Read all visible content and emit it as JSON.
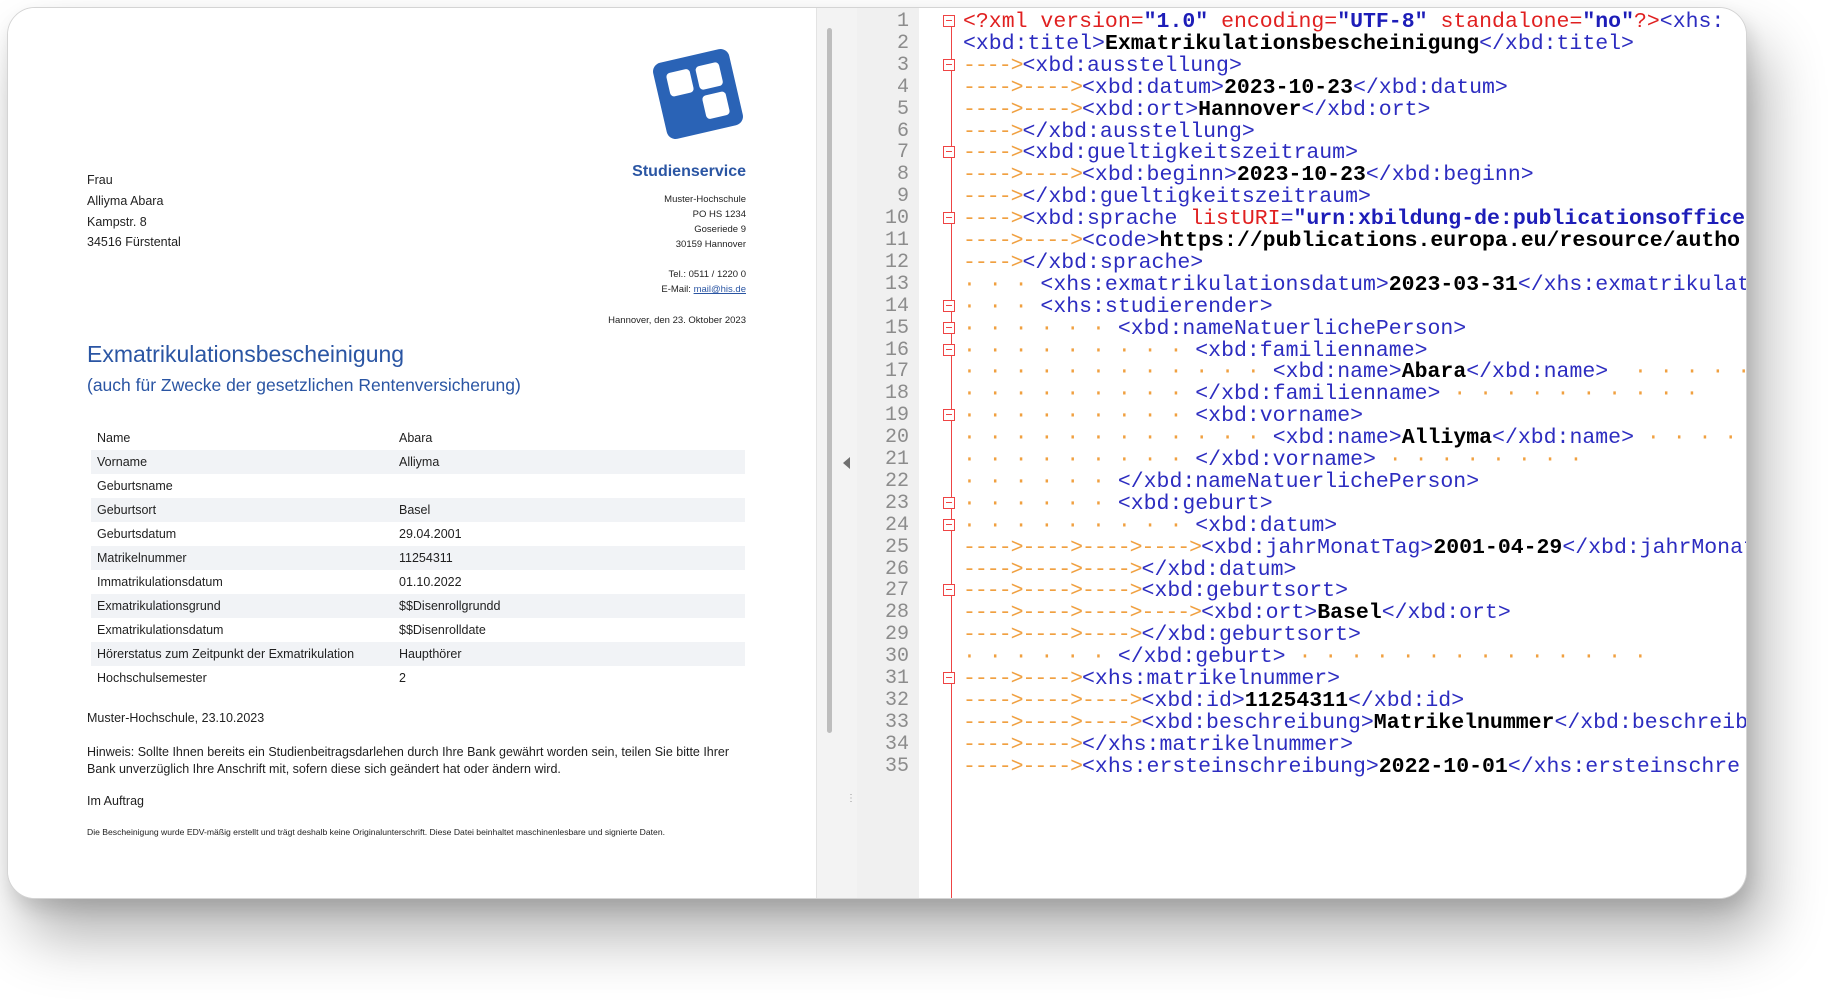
{
  "document": {
    "recipient": [
      "Frau",
      "Alliyma Abara",
      "Kampstr. 8",
      "34516 Fürstental"
    ],
    "sender": {
      "title": "Studienservice",
      "lines": [
        "Muster-Hochschule",
        "PO HS 1234",
        "Goseriede 9",
        "30159 Hannover"
      ],
      "phone": "Tel.: 0511 / 1220 0",
      "email_label": "E-Mail: ",
      "email": "mail@his.de",
      "date_line": "Hannover, den 23. Oktober 2023"
    },
    "title": "Exmatrikulationsbescheinigung",
    "subtitle": "(auch für Zwecke der gesetzlichen Rentenversicherung)",
    "table": [
      [
        "Name",
        "Abara"
      ],
      [
        "Vorname",
        "Alliyma"
      ],
      [
        "Geburtsname",
        ""
      ],
      [
        "Geburtsort",
        "Basel"
      ],
      [
        "Geburtsdatum",
        "29.04.2001"
      ],
      [
        "Matrikelnummer",
        "11254311"
      ],
      [
        "Immatrikulationsdatum",
        "01.10.2022"
      ],
      [
        "Exmatrikulationsgrund",
        "$$Disenrollgrundd"
      ],
      [
        "Exmatrikulationsdatum",
        "$$Disenrolldate"
      ],
      [
        "Hörerstatus zum Zeitpunkt der Exmatrikulation",
        "Haupthörer"
      ],
      [
        "Hochschulsemester",
        "2"
      ]
    ],
    "place_date": "Muster-Hochschule, 23.10.2023",
    "note": "Hinweis: Sollte Ihnen bereits ein Studienbeitragsdarlehen durch Ihre Bank gewährt worden sein, teilen Sie bitte Ihrer Bank unverzüglich Ihre Anschrift mit, sofern diese sich geändert hat oder ändern wird.",
    "signature_note": "Im Auftrag",
    "disclaimer": "Die Bescheinigung wurde EDV-mäßig erstellt und trägt deshalb keine Originalunterschrift. Diese Datei beinhaltet maschinenlesbare und signierte Daten."
  },
  "editor": {
    "lines": [
      {
        "n": "1",
        "fold": true,
        "indent": "",
        "parts": [
          [
            "pi",
            "<?xml "
          ],
          [
            "attr",
            "version"
          ],
          [
            "pi",
            "="
          ],
          [
            "aval",
            "\"1.0\""
          ],
          [
            "pi",
            " "
          ],
          [
            "attr",
            "encoding"
          ],
          [
            "pi",
            "="
          ],
          [
            "aval",
            "\"UTF-8\""
          ],
          [
            "pi",
            " "
          ],
          [
            "attr",
            "standalone"
          ],
          [
            "pi",
            "="
          ],
          [
            "aval",
            "\"no\""
          ],
          [
            "pi",
            "?>"
          ],
          [
            "tag",
            "<xhs:"
          ]
        ]
      },
      {
        "n": "2",
        "fold": false,
        "indent": "",
        "parts": [
          [
            "tag",
            "<xbd:titel>"
          ],
          [
            "txt",
            "Exmatrikulationsbescheinigung"
          ],
          [
            "tag",
            "</xbd:titel>"
          ]
        ]
      },
      {
        "n": "3",
        "fold": true,
        "indent": "A",
        "parts": [
          [
            "tag",
            "<xbd:ausstellung>"
          ]
        ]
      },
      {
        "n": "4",
        "fold": false,
        "indent": "AA",
        "parts": [
          [
            "tag",
            "<xbd:datum>"
          ],
          [
            "txt",
            "2023-10-23"
          ],
          [
            "tag",
            "</xbd:datum>"
          ]
        ]
      },
      {
        "n": "5",
        "fold": false,
        "indent": "AA",
        "parts": [
          [
            "tag",
            "<xbd:ort>"
          ],
          [
            "txt",
            "Hannover"
          ],
          [
            "tag",
            "</xbd:ort>"
          ]
        ]
      },
      {
        "n": "6",
        "fold": false,
        "indent": "A",
        "parts": [
          [
            "tag",
            "</xbd:ausstellung>"
          ]
        ]
      },
      {
        "n": "7",
        "fold": true,
        "indent": "A",
        "parts": [
          [
            "tag",
            "<xbd:gueltigkeitszeitraum>"
          ]
        ]
      },
      {
        "n": "8",
        "fold": false,
        "indent": "AA",
        "parts": [
          [
            "tag",
            "<xbd:beginn>"
          ],
          [
            "txt",
            "2023-10-23"
          ],
          [
            "tag",
            "</xbd:beginn>"
          ]
        ]
      },
      {
        "n": "9",
        "fold": false,
        "indent": "A",
        "parts": [
          [
            "tag",
            "</xbd:gueltigkeitszeitraum>"
          ]
        ]
      },
      {
        "n": "10",
        "fold": true,
        "indent": "A",
        "parts": [
          [
            "tag",
            "<xbd:sprache "
          ],
          [
            "attr",
            "listURI"
          ],
          [
            "tag",
            "="
          ],
          [
            "aval",
            "\"urn:xbildung-de:publicationsoffice"
          ]
        ]
      },
      {
        "n": "11",
        "fold": false,
        "indent": "AA",
        "parts": [
          [
            "tag",
            "<code>"
          ],
          [
            "txt",
            "https://publications.europa.eu/resource/autho"
          ]
        ]
      },
      {
        "n": "12",
        "fold": false,
        "indent": "A",
        "parts": [
          [
            "tag",
            "</xbd:sprache>"
          ]
        ]
      },
      {
        "n": "13",
        "fold": false,
        "indent": "D",
        "parts": [
          [
            "tag",
            "<xhs:exmatrikulationsdatum>"
          ],
          [
            "txt",
            "2023-03-31"
          ],
          [
            "tag",
            "</xhs:exmatrikulati"
          ]
        ]
      },
      {
        "n": "14",
        "fold": true,
        "indent": "D",
        "parts": [
          [
            "tag",
            "<xhs:studierender>"
          ]
        ]
      },
      {
        "n": "15",
        "fold": true,
        "indent": "DD",
        "parts": [
          [
            "tag",
            "<xbd:nameNatuerlichePerson>"
          ]
        ]
      },
      {
        "n": "16",
        "fold": true,
        "indent": "DDD",
        "parts": [
          [
            "tag",
            "<xbd:familienname>"
          ]
        ]
      },
      {
        "n": "17",
        "fold": false,
        "indent": "DDDD",
        "parts": [
          [
            "tag",
            "<xbd:name>"
          ],
          [
            "txt",
            "Abara"
          ],
          [
            "tag",
            "</xbd:name>"
          ],
          [
            "dot",
            "  · · · · · · · · · · ·"
          ]
        ]
      },
      {
        "n": "18",
        "fold": false,
        "indent": "DDD",
        "parts": [
          [
            "tag",
            "</xbd:familienname>"
          ],
          [
            "dot",
            " · · · · · · · · · ·"
          ]
        ]
      },
      {
        "n": "19",
        "fold": true,
        "indent": "DDD",
        "parts": [
          [
            "tag",
            "<xbd:vorname>"
          ]
        ]
      },
      {
        "n": "20",
        "fold": false,
        "indent": "DDDD",
        "parts": [
          [
            "tag",
            "<xbd:name>"
          ],
          [
            "txt",
            "Alliyma"
          ],
          [
            "tag",
            "</xbd:name>"
          ],
          [
            "dot",
            " · · · · · · · · · · · · · ·"
          ]
        ]
      },
      {
        "n": "21",
        "fold": false,
        "indent": "DDD",
        "parts": [
          [
            "tag",
            "</xbd:vorname>"
          ],
          [
            "dot",
            " · · · · · · · ·"
          ]
        ]
      },
      {
        "n": "22",
        "fold": false,
        "indent": "DD",
        "parts": [
          [
            "tag",
            "</xbd:nameNatuerlichePerson>"
          ]
        ]
      },
      {
        "n": "23",
        "fold": true,
        "indent": "DD",
        "parts": [
          [
            "tag",
            "<xbd:geburt>"
          ]
        ]
      },
      {
        "n": "24",
        "fold": true,
        "indent": "DDD",
        "parts": [
          [
            "tag",
            "<xbd:datum>"
          ]
        ]
      },
      {
        "n": "25",
        "fold": false,
        "indent": "AAAA",
        "parts": [
          [
            "tag",
            "<xbd:jahrMonatTag>"
          ],
          [
            "txt",
            "2001-04-29"
          ],
          [
            "tag",
            "</xbd:jahrMonat"
          ]
        ]
      },
      {
        "n": "26",
        "fold": false,
        "indent": "AAA",
        "parts": [
          [
            "tag",
            "</xbd:datum>"
          ]
        ]
      },
      {
        "n": "27",
        "fold": true,
        "indent": "AAA",
        "parts": [
          [
            "tag",
            "<xbd:geburtsort>"
          ]
        ]
      },
      {
        "n": "28",
        "fold": false,
        "indent": "AAAA",
        "parts": [
          [
            "tag",
            "<xbd:ort>"
          ],
          [
            "txt",
            "Basel"
          ],
          [
            "tag",
            "</xbd:ort>"
          ]
        ]
      },
      {
        "n": "29",
        "fold": false,
        "indent": "AAA",
        "parts": [
          [
            "tag",
            "</xbd:geburtsort>"
          ]
        ]
      },
      {
        "n": "30",
        "fold": false,
        "indent": "DD",
        "parts": [
          [
            "tag",
            "</xbd:geburt>"
          ],
          [
            "dot",
            " · · · · · · · · · · · · · ·"
          ]
        ]
      },
      {
        "n": "31",
        "fold": true,
        "indent": "AA",
        "parts": [
          [
            "tag",
            "<xhs:matrikelnummer>"
          ]
        ]
      },
      {
        "n": "32",
        "fold": false,
        "indent": "AAA",
        "parts": [
          [
            "tag",
            "<xbd:id>"
          ],
          [
            "txt",
            "11254311"
          ],
          [
            "tag",
            "</xbd:id>"
          ]
        ]
      },
      {
        "n": "33",
        "fold": false,
        "indent": "AAA",
        "parts": [
          [
            "tag",
            "<xbd:beschreibung>"
          ],
          [
            "txt",
            "Matrikelnummer"
          ],
          [
            "tag",
            "</xbd:beschreibu"
          ]
        ]
      },
      {
        "n": "34",
        "fold": false,
        "indent": "AA",
        "parts": [
          [
            "tag",
            "</xhs:matrikelnummer>"
          ]
        ]
      },
      {
        "n": "35",
        "fold": false,
        "indent": "AA",
        "parts": [
          [
            "tag",
            "<xhs:ersteinschreibung>"
          ],
          [
            "txt",
            "2022-10-01"
          ],
          [
            "tag",
            "</xhs:ersteinschre"
          ]
        ]
      }
    ]
  },
  "colors": {
    "accent_blue": "#2a55a3",
    "xml_tag": "#2c2cc0",
    "xml_attr": "#e02020",
    "fold_marker": "#e44444",
    "indent_guide": "#f0a040"
  }
}
